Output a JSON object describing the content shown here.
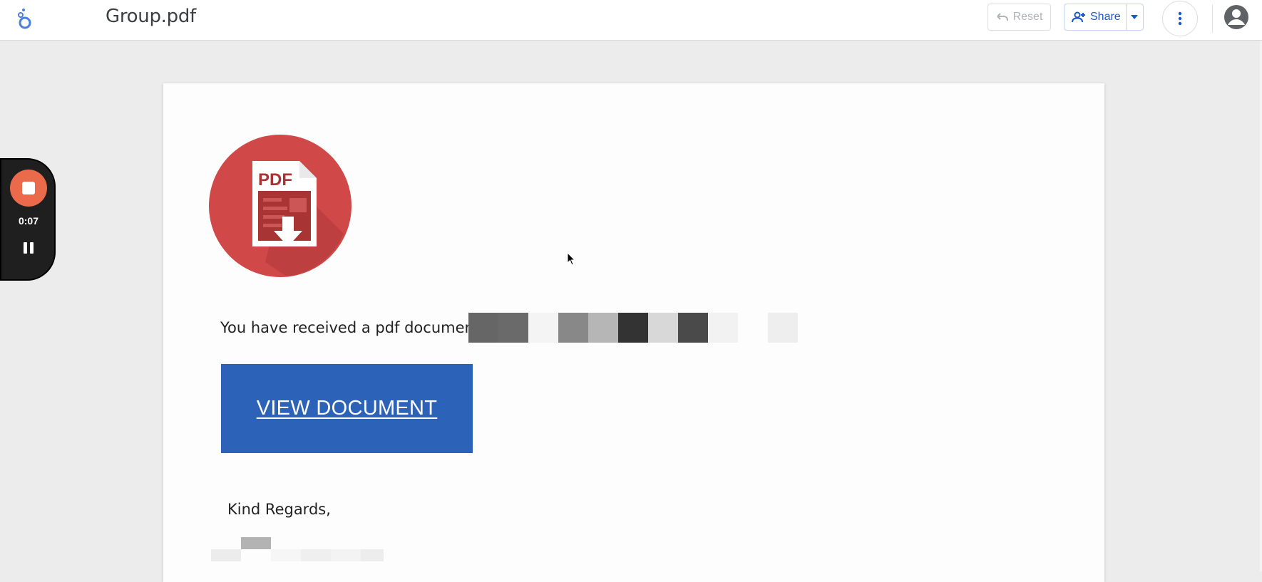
{
  "header": {
    "title": "Group.pdf",
    "reset_label": "Reset",
    "share_label": "Share"
  },
  "recorder": {
    "elapsed": "0:07"
  },
  "document": {
    "pdf_badge": "PDF",
    "received_text": "You have received a pdf document f",
    "button_label": "VIEW DOCUMENT",
    "signoff": "Kind Regards,"
  },
  "colors": {
    "accent_blue": "#2c63b8",
    "pdf_red": "#d04848",
    "record_orange": "#ec6a4c"
  }
}
